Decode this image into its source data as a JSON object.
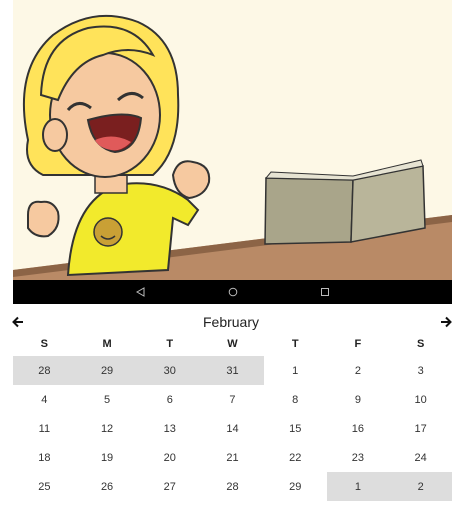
{
  "calendar": {
    "month": "February",
    "weekdays": [
      "S",
      "M",
      "T",
      "W",
      "T",
      "F",
      "S"
    ],
    "weeks": [
      [
        {
          "d": "28",
          "other": true
        },
        {
          "d": "29",
          "other": true
        },
        {
          "d": "30",
          "other": true
        },
        {
          "d": "31",
          "other": true
        },
        {
          "d": "1",
          "other": false
        },
        {
          "d": "2",
          "other": false
        },
        {
          "d": "3",
          "other": false
        }
      ],
      [
        {
          "d": "4",
          "other": false
        },
        {
          "d": "5",
          "other": false
        },
        {
          "d": "6",
          "other": false
        },
        {
          "d": "7",
          "other": false
        },
        {
          "d": "8",
          "other": false
        },
        {
          "d": "9",
          "other": false
        },
        {
          "d": "10",
          "other": false
        }
      ],
      [
        {
          "d": "11",
          "other": false
        },
        {
          "d": "12",
          "other": false
        },
        {
          "d": "13",
          "other": false
        },
        {
          "d": "14",
          "other": false
        },
        {
          "d": "15",
          "other": false
        },
        {
          "d": "16",
          "other": false
        },
        {
          "d": "17",
          "other": false
        }
      ],
      [
        {
          "d": "18",
          "other": false
        },
        {
          "d": "19",
          "other": false
        },
        {
          "d": "20",
          "other": false
        },
        {
          "d": "21",
          "other": false
        },
        {
          "d": "22",
          "other": false
        },
        {
          "d": "23",
          "other": false
        },
        {
          "d": "24",
          "other": false
        }
      ],
      [
        {
          "d": "25",
          "other": false
        },
        {
          "d": "26",
          "other": false
        },
        {
          "d": "27",
          "other": false
        },
        {
          "d": "28",
          "other": false
        },
        {
          "d": "29",
          "other": false
        },
        {
          "d": "1",
          "other": true
        },
        {
          "d": "2",
          "other": true
        }
      ]
    ]
  },
  "navigation_bar": {
    "buttons": [
      "back-icon",
      "home-icon",
      "recents-icon"
    ]
  },
  "colors": {
    "outside_month_bg": "#dddddd",
    "illustration_bg": "#fdf8e6",
    "nav_bar": "#000000"
  }
}
